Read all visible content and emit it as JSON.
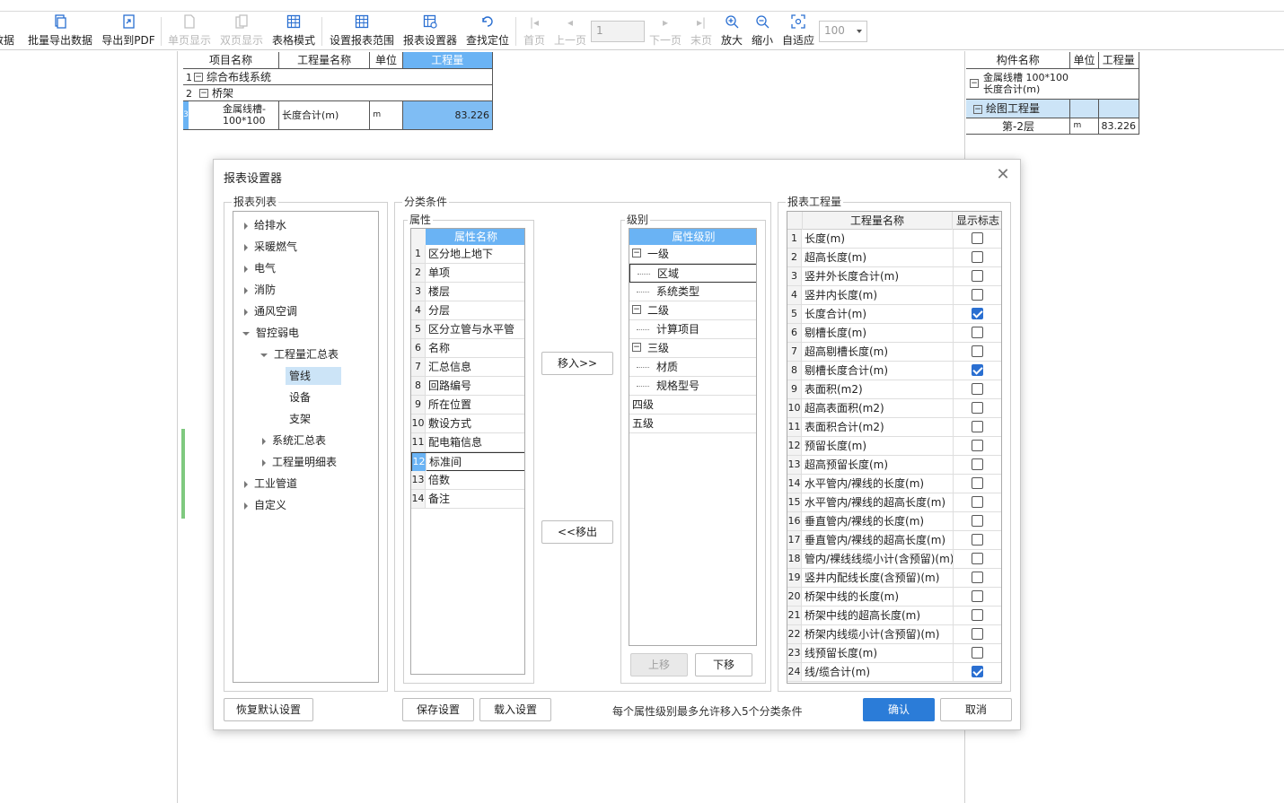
{
  "toolbar": {
    "items": [
      {
        "label": "数据",
        "icon": "export-icon",
        "enabled": true
      },
      {
        "label": "批量导出数据",
        "icon": "batch-export-icon",
        "enabled": true
      },
      {
        "label": "导出到PDF",
        "icon": "pdf-icon",
        "enabled": true
      },
      {
        "label": "单页显示",
        "icon": "single-page-icon",
        "enabled": false
      },
      {
        "label": "双页显示",
        "icon": "double-page-icon",
        "enabled": false
      },
      {
        "label": "表格模式",
        "icon": "table-icon",
        "enabled": true
      },
      {
        "label": "设置报表范围",
        "icon": "range-icon",
        "enabled": true
      },
      {
        "label": "报表设置器",
        "icon": "report-settings-icon",
        "enabled": true
      },
      {
        "label": "查找定位",
        "icon": "locate-icon",
        "enabled": true
      },
      {
        "label": "首页",
        "icon": "first-page-icon",
        "enabled": false
      },
      {
        "label": "上一页",
        "icon": "prev-page-icon",
        "enabled": false
      },
      {
        "label": "下一页",
        "icon": "next-page-icon",
        "enabled": false
      },
      {
        "label": "末页",
        "icon": "last-page-icon",
        "enabled": false
      },
      {
        "label": "放大",
        "icon": "zoom-in-icon",
        "enabled": true
      },
      {
        "label": "缩小",
        "icon": "zoom-out-icon",
        "enabled": true
      },
      {
        "label": "自适应",
        "icon": "fit-icon",
        "enabled": true
      }
    ],
    "page_value": "1",
    "zoom_value": "100"
  },
  "left_report": {
    "headers": [
      "项目名称",
      "工程量名称",
      "单位",
      "工程量"
    ],
    "row1": {
      "num": "1",
      "name": "综合布线系统"
    },
    "row2": {
      "num": "2",
      "name": "桥架"
    },
    "row3": {
      "num": "3",
      "name_line1": "金属线槽-",
      "name_line2": "100*100",
      "qty_name": "长度合计(m)",
      "unit": "m",
      "value": "83.226"
    }
  },
  "right_report": {
    "headers": [
      "构件名称",
      "单位",
      "工程量"
    ],
    "row1": {
      "line1": "金属线槽 100*100",
      "line2": "长度合计(m)"
    },
    "row2": {
      "name": "绘图工程量"
    },
    "row3": {
      "name": "第-2层",
      "unit": "m",
      "value": "83.226"
    }
  },
  "dialog": {
    "title": "报表设置器",
    "report_list": {
      "title": "报表列表",
      "items": [
        "给排水",
        "采暖燃气",
        "电气",
        "消防",
        "通风空调",
        "智控弱电",
        "工程量汇总表",
        "管线",
        "设备",
        "支架",
        "系统汇总表",
        "工程量明细表",
        "工业管道",
        "自定义"
      ]
    },
    "classify": {
      "title": "分类条件",
      "attr_title": "属性",
      "attr_header": "属性名称",
      "attrs": [
        "区分地上地下",
        "单项",
        "楼层",
        "分层",
        "区分立管与水平管",
        "名称",
        "汇总信息",
        "回路编号",
        "所在位置",
        "敷设方式",
        "配电箱信息",
        "标准间",
        "倍数",
        "备注"
      ],
      "move_in": "移入>>",
      "move_out": "<<移出",
      "level_title": "级别",
      "level_header": "属性级别",
      "levels": [
        "一级",
        "区域",
        "系统类型",
        "二级",
        "计算项目",
        "三级",
        "材质",
        "规格型号",
        "四级",
        "五级"
      ],
      "up": "上移",
      "down": "下移"
    },
    "quantity": {
      "title": "报表工程量",
      "col_name": "工程量名称",
      "col_flag": "显示标志",
      "rows": [
        {
          "name": "长度(m)",
          "checked": false
        },
        {
          "name": "超高长度(m)",
          "checked": false
        },
        {
          "name": "竖井外长度合计(m)",
          "checked": false
        },
        {
          "name": "竖井内长度(m)",
          "checked": false
        },
        {
          "name": "长度合计(m)",
          "checked": true
        },
        {
          "name": "剔槽长度(m)",
          "checked": false
        },
        {
          "name": "超高剔槽长度(m)",
          "checked": false
        },
        {
          "name": "剔槽长度合计(m)",
          "checked": true
        },
        {
          "name": "表面积(m2)",
          "checked": false
        },
        {
          "name": "超高表面积(m2)",
          "checked": false
        },
        {
          "name": "表面积合计(m2)",
          "checked": false
        },
        {
          "name": "预留长度(m)",
          "checked": false
        },
        {
          "name": "超高预留长度(m)",
          "checked": false
        },
        {
          "name": "水平管内/裸线的长度(m)",
          "checked": false
        },
        {
          "name": "水平管内/裸线的超高长度(m)",
          "checked": false
        },
        {
          "name": "垂直管内/裸线的长度(m)",
          "checked": false
        },
        {
          "name": "垂直管内/裸线的超高长度(m)",
          "checked": false
        },
        {
          "name": "管内/裸线线缆小计(含预留)(m)",
          "checked": false
        },
        {
          "name": "竖井内配线长度(含预留)(m)",
          "checked": false
        },
        {
          "name": "桥架中线的长度(m)",
          "checked": false
        },
        {
          "name": "桥架中线的超高长度(m)",
          "checked": false
        },
        {
          "name": "桥架内线缆小计(含预留)(m)",
          "checked": false
        },
        {
          "name": "线预留长度(m)",
          "checked": false
        },
        {
          "name": "线/缆合计(m)",
          "checked": true
        }
      ]
    },
    "buttons": {
      "restore": "恢复默认设置",
      "save": "保存设置",
      "load": "载入设置",
      "hint": "每个属性级别最多允许移入5个分类条件",
      "ok": "确认",
      "cancel": "取消"
    }
  },
  "colors": {
    "accent": "#2b7cd8",
    "header_blue": "#6ab3f4",
    "selection": "#cce4f7"
  }
}
